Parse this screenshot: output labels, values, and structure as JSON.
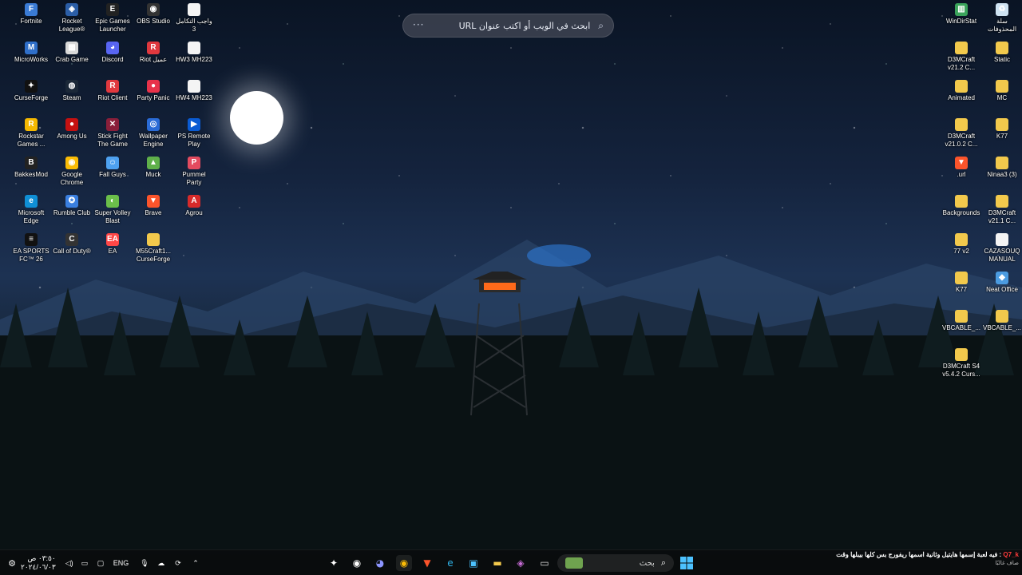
{
  "browser_search": {
    "placeholder": "ابحث في الويب أو اكتب عنوان URL",
    "more": "···"
  },
  "desktop_left": [
    {
      "label": "Fortnite",
      "icon": "fortnite-icon",
      "color": "#3a7bd5",
      "glyph": "F"
    },
    {
      "label": "Rocket League®",
      "icon": "rocket-league-icon",
      "color": "#2b5ea7",
      "glyph": "◈"
    },
    {
      "label": "Epic Games Launcher",
      "icon": "epic-games-icon",
      "color": "#222",
      "glyph": "E"
    },
    {
      "label": "OBS Studio",
      "icon": "obs-icon",
      "color": "#333",
      "glyph": "◉"
    },
    {
      "label": "واجب التكامل 3",
      "icon": "document-icon",
      "color": "#f4f4f4",
      "glyph": ""
    },
    {
      "label": "MicroWorks",
      "icon": "microworks-icon",
      "color": "#2f6fc9",
      "glyph": "M"
    },
    {
      "label": "Crab Game",
      "icon": "crab-game-icon",
      "color": "#d9d9d9",
      "glyph": "▦"
    },
    {
      "label": "Discord",
      "icon": "discord-icon",
      "color": "#5865f2",
      "glyph": "◕"
    },
    {
      "label": "Riot عميل",
      "icon": "riot-client-icon",
      "color": "#e0383e",
      "glyph": "R"
    },
    {
      "label": "HW3 MH223",
      "icon": "document-icon",
      "color": "#f4f4f4",
      "glyph": ""
    },
    {
      "label": "CurseForge",
      "icon": "curseforge-icon",
      "color": "#111",
      "glyph": "✦"
    },
    {
      "label": "Steam",
      "icon": "steam-icon",
      "color": "#1b2838",
      "glyph": "◍"
    },
    {
      "label": "Riot Client",
      "icon": "riot-client-icon",
      "color": "#e0383e",
      "glyph": "R"
    },
    {
      "label": "Party Panic",
      "icon": "party-panic-icon",
      "color": "#e8324a",
      "glyph": "●"
    },
    {
      "label": "HW4 MH223",
      "icon": "document-icon",
      "color": "#f4f4f4",
      "glyph": ""
    },
    {
      "label": "Rockstar Games ...",
      "icon": "rockstar-icon",
      "color": "#f5b800",
      "glyph": "R"
    },
    {
      "label": "Among Us",
      "icon": "among-us-icon",
      "color": "#c51111",
      "glyph": "●"
    },
    {
      "label": "Stick Fight The Game",
      "icon": "stick-fight-icon",
      "color": "#8a1f3a",
      "glyph": "✕"
    },
    {
      "label": "Wallpaper Engine",
      "icon": "wallpaper-engine-icon",
      "color": "#2a6bd6",
      "glyph": "◎"
    },
    {
      "label": "PS Remote Play",
      "icon": "ps-remote-play-icon",
      "color": "#0a5bd3",
      "glyph": "▶"
    },
    {
      "label": "BakkesMod",
      "icon": "bakkesmod-icon",
      "color": "#222",
      "glyph": "B"
    },
    {
      "label": "Google Chrome",
      "icon": "chrome-icon",
      "color": "#fbbc05",
      "glyph": "◉"
    },
    {
      "label": "Fall Guys",
      "icon": "fall-guys-icon",
      "color": "#4ea1f0",
      "glyph": "☺"
    },
    {
      "label": "Muck",
      "icon": "muck-icon",
      "color": "#5fb04a",
      "glyph": "▲"
    },
    {
      "label": "Pummel Party",
      "icon": "pummel-party-icon",
      "color": "#e34b5f",
      "glyph": "P"
    },
    {
      "label": "Microsoft Edge",
      "icon": "edge-icon",
      "color": "#0f8fd6",
      "glyph": "e"
    },
    {
      "label": "Rumble Club",
      "icon": "rumble-club-icon",
      "color": "#3a7fe0",
      "glyph": "✪"
    },
    {
      "label": "Super Volley Blast",
      "icon": "super-volley-blast-icon",
      "color": "#6bbf4a",
      "glyph": "◐"
    },
    {
      "label": "Brave",
      "icon": "brave-icon",
      "color": "#fb542b",
      "glyph": "▼"
    },
    {
      "label": "Agrou",
      "icon": "agrou-icon",
      "color": "#d72a2a",
      "glyph": "A"
    },
    {
      "label": "EA SPORTS FC™ 26",
      "icon": "ea-fc-icon",
      "color": "#111",
      "glyph": "≡"
    },
    {
      "label": "Call of Duty®",
      "icon": "call-of-duty-icon",
      "color": "#333",
      "glyph": "C"
    },
    {
      "label": "EA",
      "icon": "ea-icon",
      "color": "#ff4747",
      "glyph": "EA"
    },
    {
      "label": "M55Craft1... CurseForge",
      "icon": "folder-icon",
      "color": "#f2c94c",
      "glyph": ""
    }
  ],
  "desktop_right": [
    {
      "label": "WinDirStat",
      "icon": "windirstat-icon",
      "color": "#3aa35b",
      "glyph": "▥"
    },
    {
      "label": "سلة المحذوفات",
      "icon": "recycle-bin-icon",
      "color": "#cfe3f3",
      "glyph": "♻"
    },
    {
      "label": "D3MCraft v21.2 C...",
      "icon": "folder-icon",
      "color": "#f2c94c",
      "glyph": ""
    },
    {
      "label": "Static",
      "icon": "folder-icon",
      "color": "#f2c94c",
      "glyph": ""
    },
    {
      "label": "Animated",
      "icon": "folder-icon",
      "color": "#f2c94c",
      "glyph": ""
    },
    {
      "label": "MC",
      "icon": "folder-icon",
      "color": "#f2c94c",
      "glyph": ""
    },
    {
      "label": "D3MCraft v21.0.2 C...",
      "icon": "folder-icon",
      "color": "#f2c94c",
      "glyph": ""
    },
    {
      "label": "K77",
      "icon": "folder-icon",
      "color": "#f2c94c",
      "glyph": ""
    },
    {
      "label": ".url",
      "icon": "brave-icon",
      "color": "#fb542b",
      "glyph": "▼"
    },
    {
      "label": "Ninaa3 (3)",
      "icon": "folder-icon",
      "color": "#f2c94c",
      "glyph": ""
    },
    {
      "label": "Backgrounds",
      "icon": "folder-icon",
      "color": "#f2c94c",
      "glyph": ""
    },
    {
      "label": "D3MCraft v21.1 C...",
      "icon": "folder-icon",
      "color": "#f2c94c",
      "glyph": ""
    },
    {
      "label": "77 v2",
      "icon": "folder-icon",
      "color": "#f2c94c",
      "glyph": ""
    },
    {
      "label": "CAZASOUQ MANUAL",
      "icon": "document-icon",
      "color": "#f4f4f4",
      "glyph": ""
    },
    {
      "label": "K77",
      "icon": "folder-icon",
      "color": "#f2c94c",
      "glyph": ""
    },
    {
      "label": "Neat Office",
      "icon": "neat-office-icon",
      "color": "#4b9be0",
      "glyph": "◆"
    },
    {
      "label": "VBCABLE_...",
      "icon": "folder-icon",
      "color": "#f2c94c",
      "glyph": ""
    },
    {
      "label": "VBCABLE_...",
      "icon": "folder-icon",
      "color": "#f2c94c",
      "glyph": ""
    },
    {
      "label": "D3MCraft S4 v5.4.2 Curs...",
      "icon": "folder-icon",
      "color": "#f2c94c",
      "glyph": ""
    }
  ],
  "taskbar": {
    "search_placeholder": "بحث",
    "apps": [
      {
        "name": "curseforge-taskbar-icon",
        "glyph": "✦",
        "color": "#ffffff"
      },
      {
        "name": "obs-taskbar-icon",
        "glyph": "◉",
        "color": "#ffffff"
      },
      {
        "name": "discord-taskbar-icon",
        "glyph": "◕",
        "color": "#8c95ff"
      },
      {
        "name": "chrome-taskbar-icon",
        "glyph": "◉",
        "color": "#fbbc05"
      },
      {
        "name": "brave-taskbar-icon",
        "glyph": "▼",
        "color": "#fb542b"
      },
      {
        "name": "edge-taskbar-icon",
        "glyph": "e",
        "color": "#2fb3e8"
      },
      {
        "name": "store-taskbar-icon",
        "glyph": "▣",
        "color": "#4cc2ff"
      },
      {
        "name": "file-explorer-taskbar-icon",
        "glyph": "▬",
        "color": "#f2c94c"
      },
      {
        "name": "copilot-taskbar-icon",
        "glyph": "◈",
        "color": "#c86dd7"
      },
      {
        "name": "task-view-icon",
        "glyph": "▭",
        "color": "#dddddd"
      }
    ],
    "tray": {
      "time": "٠٣:٥٠ ص",
      "date": "٢٠٢٤/٠٦/٠٣",
      "language": "ENG"
    }
  },
  "notification": {
    "username": "Q7_k",
    "message": "فيه لعبة إسمها هايتيل وثانية اسمها ريفورج بس كلها بيبلها وقت",
    "weather": "صاف غالبًا"
  }
}
